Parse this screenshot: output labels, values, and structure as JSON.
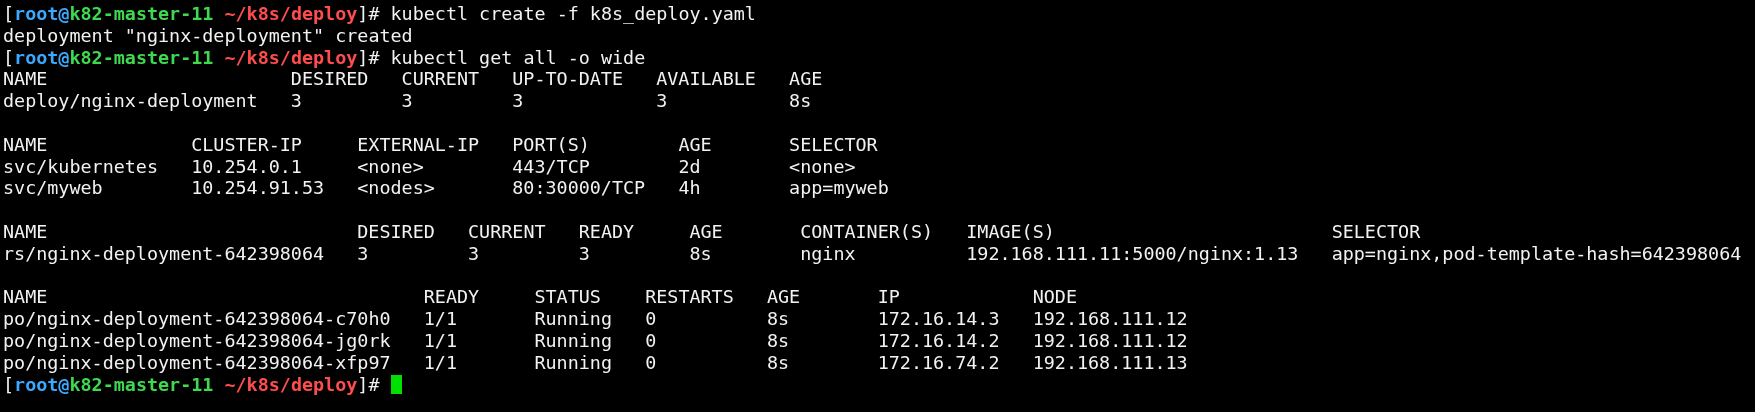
{
  "terminal": {
    "lines": [
      {
        "kind": "prompt",
        "open": "[",
        "user": "root@",
        "host": "k82-master-11",
        "path": "~/k8s/deploy",
        "close": "]#",
        "command": "kubectl create -f k8s_deploy.yaml",
        "cursor": false
      },
      {
        "kind": "output",
        "text": "deployment \"nginx-deployment\" created"
      },
      {
        "kind": "prompt",
        "open": "[",
        "user": "root@",
        "host": "k82-master-11",
        "path": "~/k8s/deploy",
        "close": "]#",
        "command": "kubectl get all -o wide",
        "cursor": false
      },
      {
        "kind": "table",
        "columns": [
          "NAME",
          "DESIRED",
          "CURRENT",
          "UP-TO-DATE",
          "AVAILABLE",
          "AGE"
        ],
        "rows": [
          [
            "deploy/nginx-deployment",
            "3",
            "3",
            "3",
            "3",
            "8s"
          ]
        ]
      },
      {
        "kind": "blank"
      },
      {
        "kind": "table",
        "columns": [
          "NAME",
          "CLUSTER-IP",
          "EXTERNAL-IP",
          "PORT(S)",
          "AGE",
          "SELECTOR"
        ],
        "rows": [
          [
            "svc/kubernetes",
            "10.254.0.1",
            "<none>",
            "443/TCP",
            "2d",
            "<none>"
          ],
          [
            "svc/myweb",
            "10.254.91.53",
            "<nodes>",
            "80:30000/TCP",
            "4h",
            "app=myweb"
          ]
        ]
      },
      {
        "kind": "blank"
      },
      {
        "kind": "table",
        "columns": [
          "NAME",
          "DESIRED",
          "CURRENT",
          "READY",
          "AGE",
          "CONTAINER(S)",
          "IMAGE(S)",
          "SELECTOR"
        ],
        "rows": [
          [
            "rs/nginx-deployment-642398064",
            "3",
            "3",
            "3",
            "8s",
            "nginx",
            "192.168.111.11:5000/nginx:1.13",
            "app=nginx,pod-template-hash=642398064"
          ]
        ]
      },
      {
        "kind": "blank"
      },
      {
        "kind": "table",
        "columns": [
          "NAME",
          "READY",
          "STATUS",
          "RESTARTS",
          "AGE",
          "IP",
          "NODE"
        ],
        "rows": [
          [
            "po/nginx-deployment-642398064-c70h0",
            "1/1",
            "Running",
            "0",
            "8s",
            "172.16.14.3",
            "192.168.111.12"
          ],
          [
            "po/nginx-deployment-642398064-jg0rk",
            "1/1",
            "Running",
            "0",
            "8s",
            "172.16.14.2",
            "192.168.111.12"
          ],
          [
            "po/nginx-deployment-642398064-xfp97",
            "1/1",
            "Running",
            "0",
            "8s",
            "172.16.74.2",
            "192.168.111.13"
          ]
        ]
      },
      {
        "kind": "prompt",
        "open": "[",
        "user": "root@",
        "host": "k82-master-11",
        "path": "~/k8s/deploy",
        "close": "]#",
        "cursor": true
      }
    ]
  }
}
